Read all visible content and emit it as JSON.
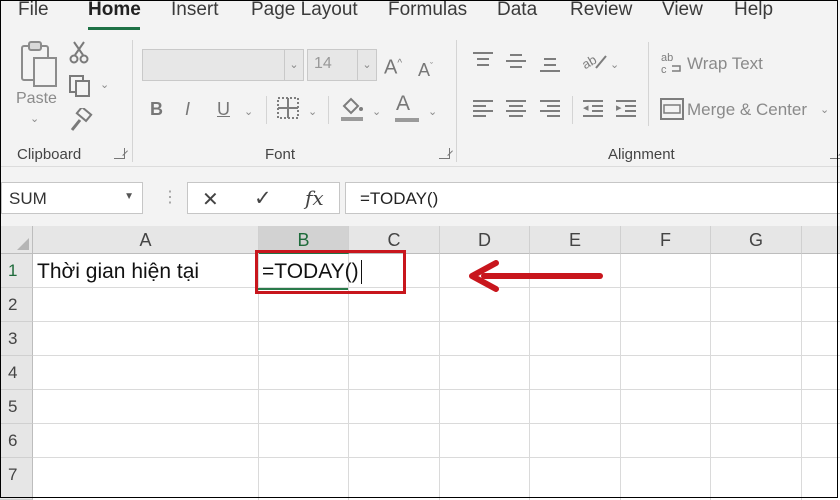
{
  "tabs": [
    "File",
    "Home",
    "Insert",
    "Page Layout",
    "Formulas",
    "Data",
    "Review",
    "View",
    "Help"
  ],
  "active_tab": "Home",
  "ribbon": {
    "clipboard": {
      "paste_label": "Paste",
      "group_label": "Clipboard"
    },
    "font": {
      "font_name": "",
      "font_size": "14",
      "bold": "B",
      "italic": "I",
      "underline": "U",
      "font_color_glyph": "A",
      "grow_font": "A",
      "shrink_font": "A",
      "group_label": "Font"
    },
    "alignment": {
      "wrap_text": "Wrap Text",
      "merge_center": "Merge & Center",
      "group_label": "Alignment"
    }
  },
  "formula_bar": {
    "name_box": "SUM",
    "cancel_glyph": "✕",
    "enter_glyph": "✓",
    "fx_label": "fx",
    "formula": "=TODAY()"
  },
  "sheet": {
    "columns": [
      "A",
      "B",
      "C",
      "D",
      "E",
      "F",
      "G"
    ],
    "rows": [
      "1",
      "2",
      "3",
      "4",
      "5",
      "6",
      "7"
    ],
    "cells": {
      "A1": "Thời gian hiện tại",
      "B1": "=TODAY()"
    },
    "active_cell": "B1"
  },
  "colors": {
    "accent": "#217346",
    "annotation": "#c8161d"
  },
  "icons": [
    "copy-icon",
    "cut-icon",
    "format-painter-icon",
    "borders-icon",
    "fill-color-icon",
    "font-color-icon",
    "orientation-icon",
    "wrap-text-icon",
    "merge-center-icon",
    "cancel-icon",
    "enter-icon",
    "fx-icon",
    "annotation-arrow"
  ]
}
